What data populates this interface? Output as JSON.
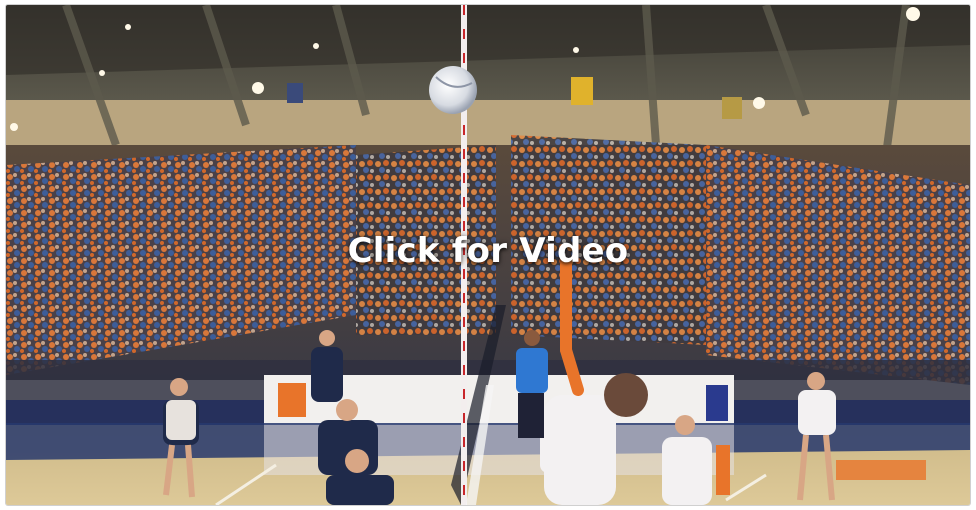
{
  "video": {
    "overlay_text": "Click for Video"
  },
  "colors": {
    "team_orange": "#e8742a",
    "team_navy": "#1f2a4a",
    "court_floor": "#d6c28c",
    "court_blue": "#27386d",
    "net_red": "#c8262b"
  },
  "scene": {
    "description_icons": [
      "volleyball-icon",
      "net-pole",
      "players",
      "crowd"
    ]
  }
}
